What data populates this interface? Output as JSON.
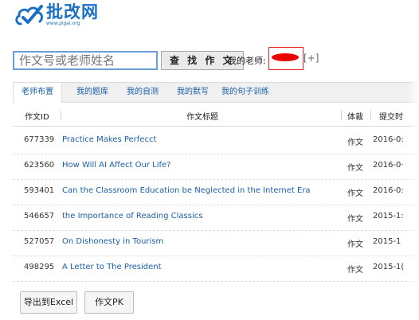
{
  "brand": {
    "name_cn": "批改网",
    "url": "www.pigai.org",
    "color": "#1b70c6"
  },
  "search": {
    "placeholder": "作文号或老师姓名",
    "button_label": "查 找 作 文"
  },
  "teacher": {
    "label": "我的老师:",
    "add_label": "[+]"
  },
  "tabs": [
    {
      "label": "老师布置",
      "active": true
    },
    {
      "label": "我的题库",
      "active": false
    },
    {
      "label": "我的自测",
      "active": false
    },
    {
      "label": "我的默写",
      "active": false
    },
    {
      "label": "我的句子训练",
      "active": false
    }
  ],
  "table": {
    "headers": {
      "id": "作文ID",
      "title": "作文标题",
      "genre": "体裁",
      "date": "提交时"
    },
    "rows": [
      {
        "id": "677339",
        "title": "Practice Makes Perfecct",
        "genre": "作文",
        "date": "2016-0:"
      },
      {
        "id": "623560",
        "title": "How Will AI Affect Our Life?",
        "genre": "作文",
        "date": "2016-0·"
      },
      {
        "id": "593401",
        "title": "Can the Classroom Education be Neglected in the Internet Era",
        "genre": "作文",
        "date": "2016-0:"
      },
      {
        "id": "546657",
        "title": "the Importance of Reading Classics",
        "genre": "作文",
        "date": "2015-1:"
      },
      {
        "id": "527057",
        "title": "On Dishonesty in Tourism",
        "genre": "作文",
        "date": "2015-1"
      },
      {
        "id": "498295",
        "title": "A Letter to The President",
        "genre": "作文",
        "date": "2015-1("
      }
    ]
  },
  "actions": {
    "export_label": "导出到Excel",
    "pk_label": "作文PK"
  }
}
